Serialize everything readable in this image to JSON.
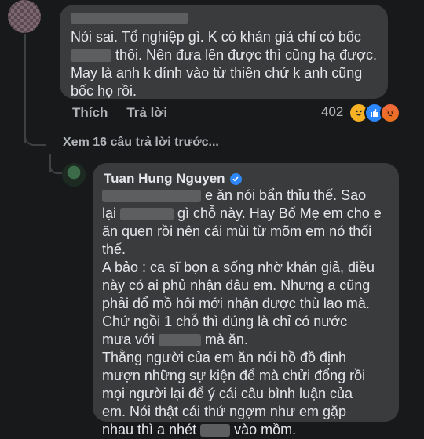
{
  "comment1": {
    "text_line1": "Nói sai. Tổ nghiệp gì. K có khán giả chỉ có bốc",
    "text_line2_after": " thôi. Nên đưa lên được thì cũng hạ được.",
    "text_line3": "May là anh k dính vào từ thiên chứ k anh cũng",
    "text_line4": "bốc họ rồi.",
    "actions": {
      "like": "Thích",
      "reply": "Trả lời"
    },
    "reaction_count": "402",
    "reactions": [
      "haha-icon",
      "like-icon",
      "angry-icon"
    ]
  },
  "thread": {
    "more_replies": "Xem 16 câu trả lời trước..."
  },
  "comment2": {
    "author": "Tuan Hung Nguyen",
    "l1_after": " e ăn nói bẩn thỉu thế. Sao",
    "l2_before": "lại ",
    "l2_after": " gì chỗ này. Hay Bố Mẹ em cho e",
    "l3": "ăn quen rồi nên cái mùi từ mõm em nó thối",
    "l4": "thế.",
    "l5": "A bảo : ca sĩ bọn a sống nhờ khán giả, điều",
    "l6": "này có ai phủ nhận đâu em. Nhưng a cũng",
    "l7": "phải đổ mồ hôi mới nhận được thù lao mà.",
    "l8": "Chứ ngồi 1 chỗ thì đúng là chỉ có nước",
    "l9_before": "mưa với ",
    "l9_after": " mà ăn.",
    "l10": "Thằng người của em ăn nói hồ đồ định",
    "l11": "mượn những sự kiện để mà chửi đổng rồi",
    "l12": "mọi người  lại để ý cái câu bình luận của",
    "l13": "em.  Nói thật cái thứ ngợm như em gặp",
    "l14_before": "nhau thì a nhét ",
    "l14_after": " vào mồm."
  },
  "colors": {
    "background": "#18191a",
    "bubble": "#3a3b3c",
    "text": "#e4e6eb",
    "muted": "#b0b3b8",
    "verified": "#2d88ff"
  }
}
